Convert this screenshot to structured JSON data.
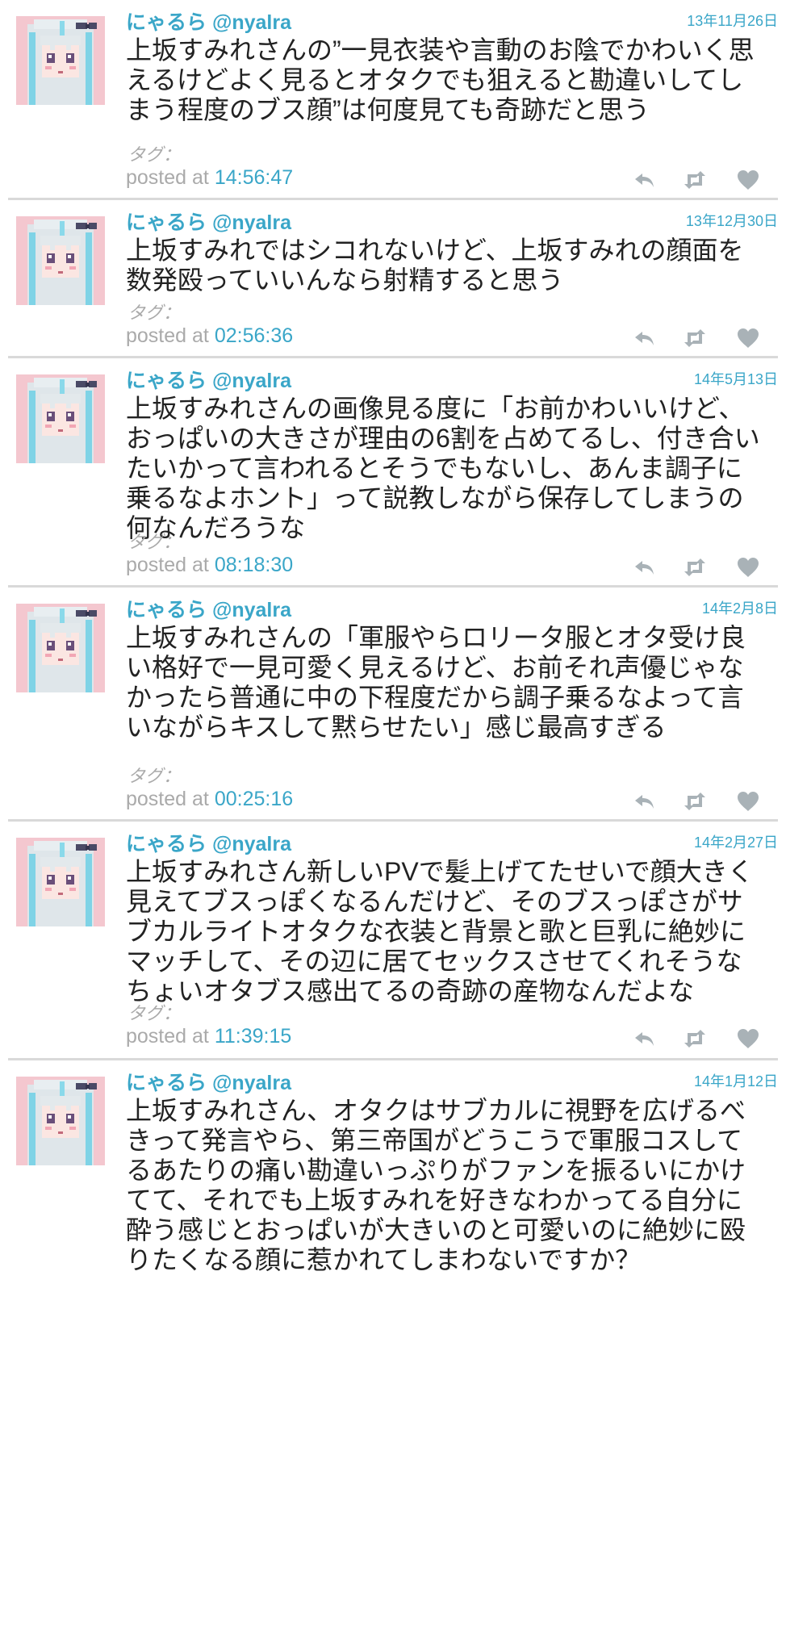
{
  "theme": {
    "accent": "#3aa6c8",
    "muted": "#aaaaaa",
    "text": "#222222",
    "icon": "#a9b2b7",
    "divider": "#d9d9d9"
  },
  "tweets": [
    {
      "name": "にゃるら",
      "handle": "@nyalra",
      "date": "13年11月26日",
      "text": "上坂すみれさんの”一見衣装や言動のお陰でかわいく思えるけどよく見るとオタクでも狙えると勘違いしてしまう程度のブス顔”は何度見ても奇跡だと思う",
      "tag_label": "タグ：",
      "posted_label": "posted at",
      "posted_time": "14:56:47",
      "icons": [
        "reply-icon",
        "retweet-icon",
        "heart-icon"
      ]
    },
    {
      "name": "にゃるら",
      "handle": "@nyalra",
      "date": "13年12月30日",
      "text": "上坂すみれではシコれないけど、上坂すみれの顔面を数発殴っていいんなら射精すると思う",
      "tag_label": "タグ：",
      "posted_label": "posted at",
      "posted_time": "02:56:36",
      "icons": [
        "reply-icon",
        "retweet-icon",
        "heart-icon"
      ]
    },
    {
      "name": "にゃるら",
      "handle": "@nyalra",
      "date": "14年5月13日",
      "text": "上坂すみれさんの画像見る度に「お前かわいいけど、おっぱいの大きさが理由の6割を占めてるし、付き合いたいかって言われるとそうでもないし、あんま調子に乗るなよホント」って説教しながら保存してしまうの何なんだろうな",
      "tag_label": "タグ：",
      "posted_label": "posted at",
      "posted_time": "08:18:30",
      "icons": [
        "reply-icon",
        "retweet-icon",
        "heart-icon"
      ]
    },
    {
      "name": "にゃるら",
      "handle": "@nyalra",
      "date": "14年2月8日",
      "text": "上坂すみれさんの「軍服やらロリータ服とオタ受け良い格好で一見可愛く見えるけど、お前それ声優じゃなかったら普通に中の下程度だから調子乗るなよって言いながらキスして黙らせたい」感じ最高すぎる",
      "tag_label": "タグ：",
      "posted_label": "posted at",
      "posted_time": "00:25:16",
      "icons": [
        "reply-icon",
        "retweet-icon",
        "heart-icon"
      ]
    },
    {
      "name": "にゃるら",
      "handle": "@nyalra",
      "date": "14年2月27日",
      "text": "上坂すみれさん新しいPVで髪上げてたせいで顔大きく見えてブスっぽくなるんだけど、そのブスっぽさがサブカルライトオタクな衣装と背景と歌と巨乳に絶妙にマッチして、その辺に居てセックスさせてくれそうなちょいオタブス感出てるの奇跡の産物なんだよな",
      "tag_label": "タグ：",
      "posted_label": "posted at",
      "posted_time": "11:39:15",
      "icons": [
        "reply-icon",
        "retweet-icon",
        "heart-icon"
      ]
    },
    {
      "name": "にゃるら",
      "handle": "@nyalra",
      "date": "14年1月12日",
      "text": "上坂すみれさん、オタクはサブカルに視野を広げるべきって発言やら、第三帝国がどうこうで軍服コスしてるあたりの痛い勘違いっぷりがファンを振るいにかけてて、それでも上坂すみれを好きなわかってる自分に酔う感じとおっぱいが大きいのと可愛いのに絶妙に殴りたくなる顔に惹かれてしまわないですか？",
      "tag_label": "",
      "posted_label": "",
      "posted_time": "",
      "icons": []
    }
  ]
}
